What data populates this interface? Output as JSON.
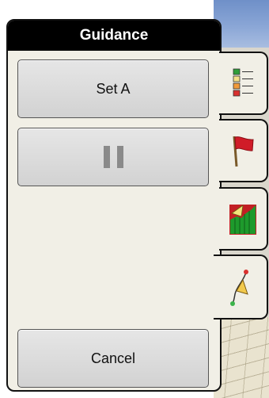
{
  "panel": {
    "title": "Guidance"
  },
  "buttons": {
    "set_a_label": "Set A",
    "pause_icon": "pause-icon",
    "cancel_label": "Cancel"
  },
  "tabs": [
    {
      "name": "legend-tab",
      "icon": "legend-icon"
    },
    {
      "name": "flag-tab",
      "icon": "flag-icon"
    },
    {
      "name": "coverage-tab",
      "icon": "coverage-chart-icon"
    },
    {
      "name": "guidance-tab",
      "icon": "guidance-line-icon",
      "selected": true
    }
  ],
  "colors": {
    "title_bar": "#000000",
    "panel_bg": "#f1efe6",
    "flag": "#d01c28",
    "chart_green": "#1e9a2c",
    "chart_red": "#c21f24"
  }
}
